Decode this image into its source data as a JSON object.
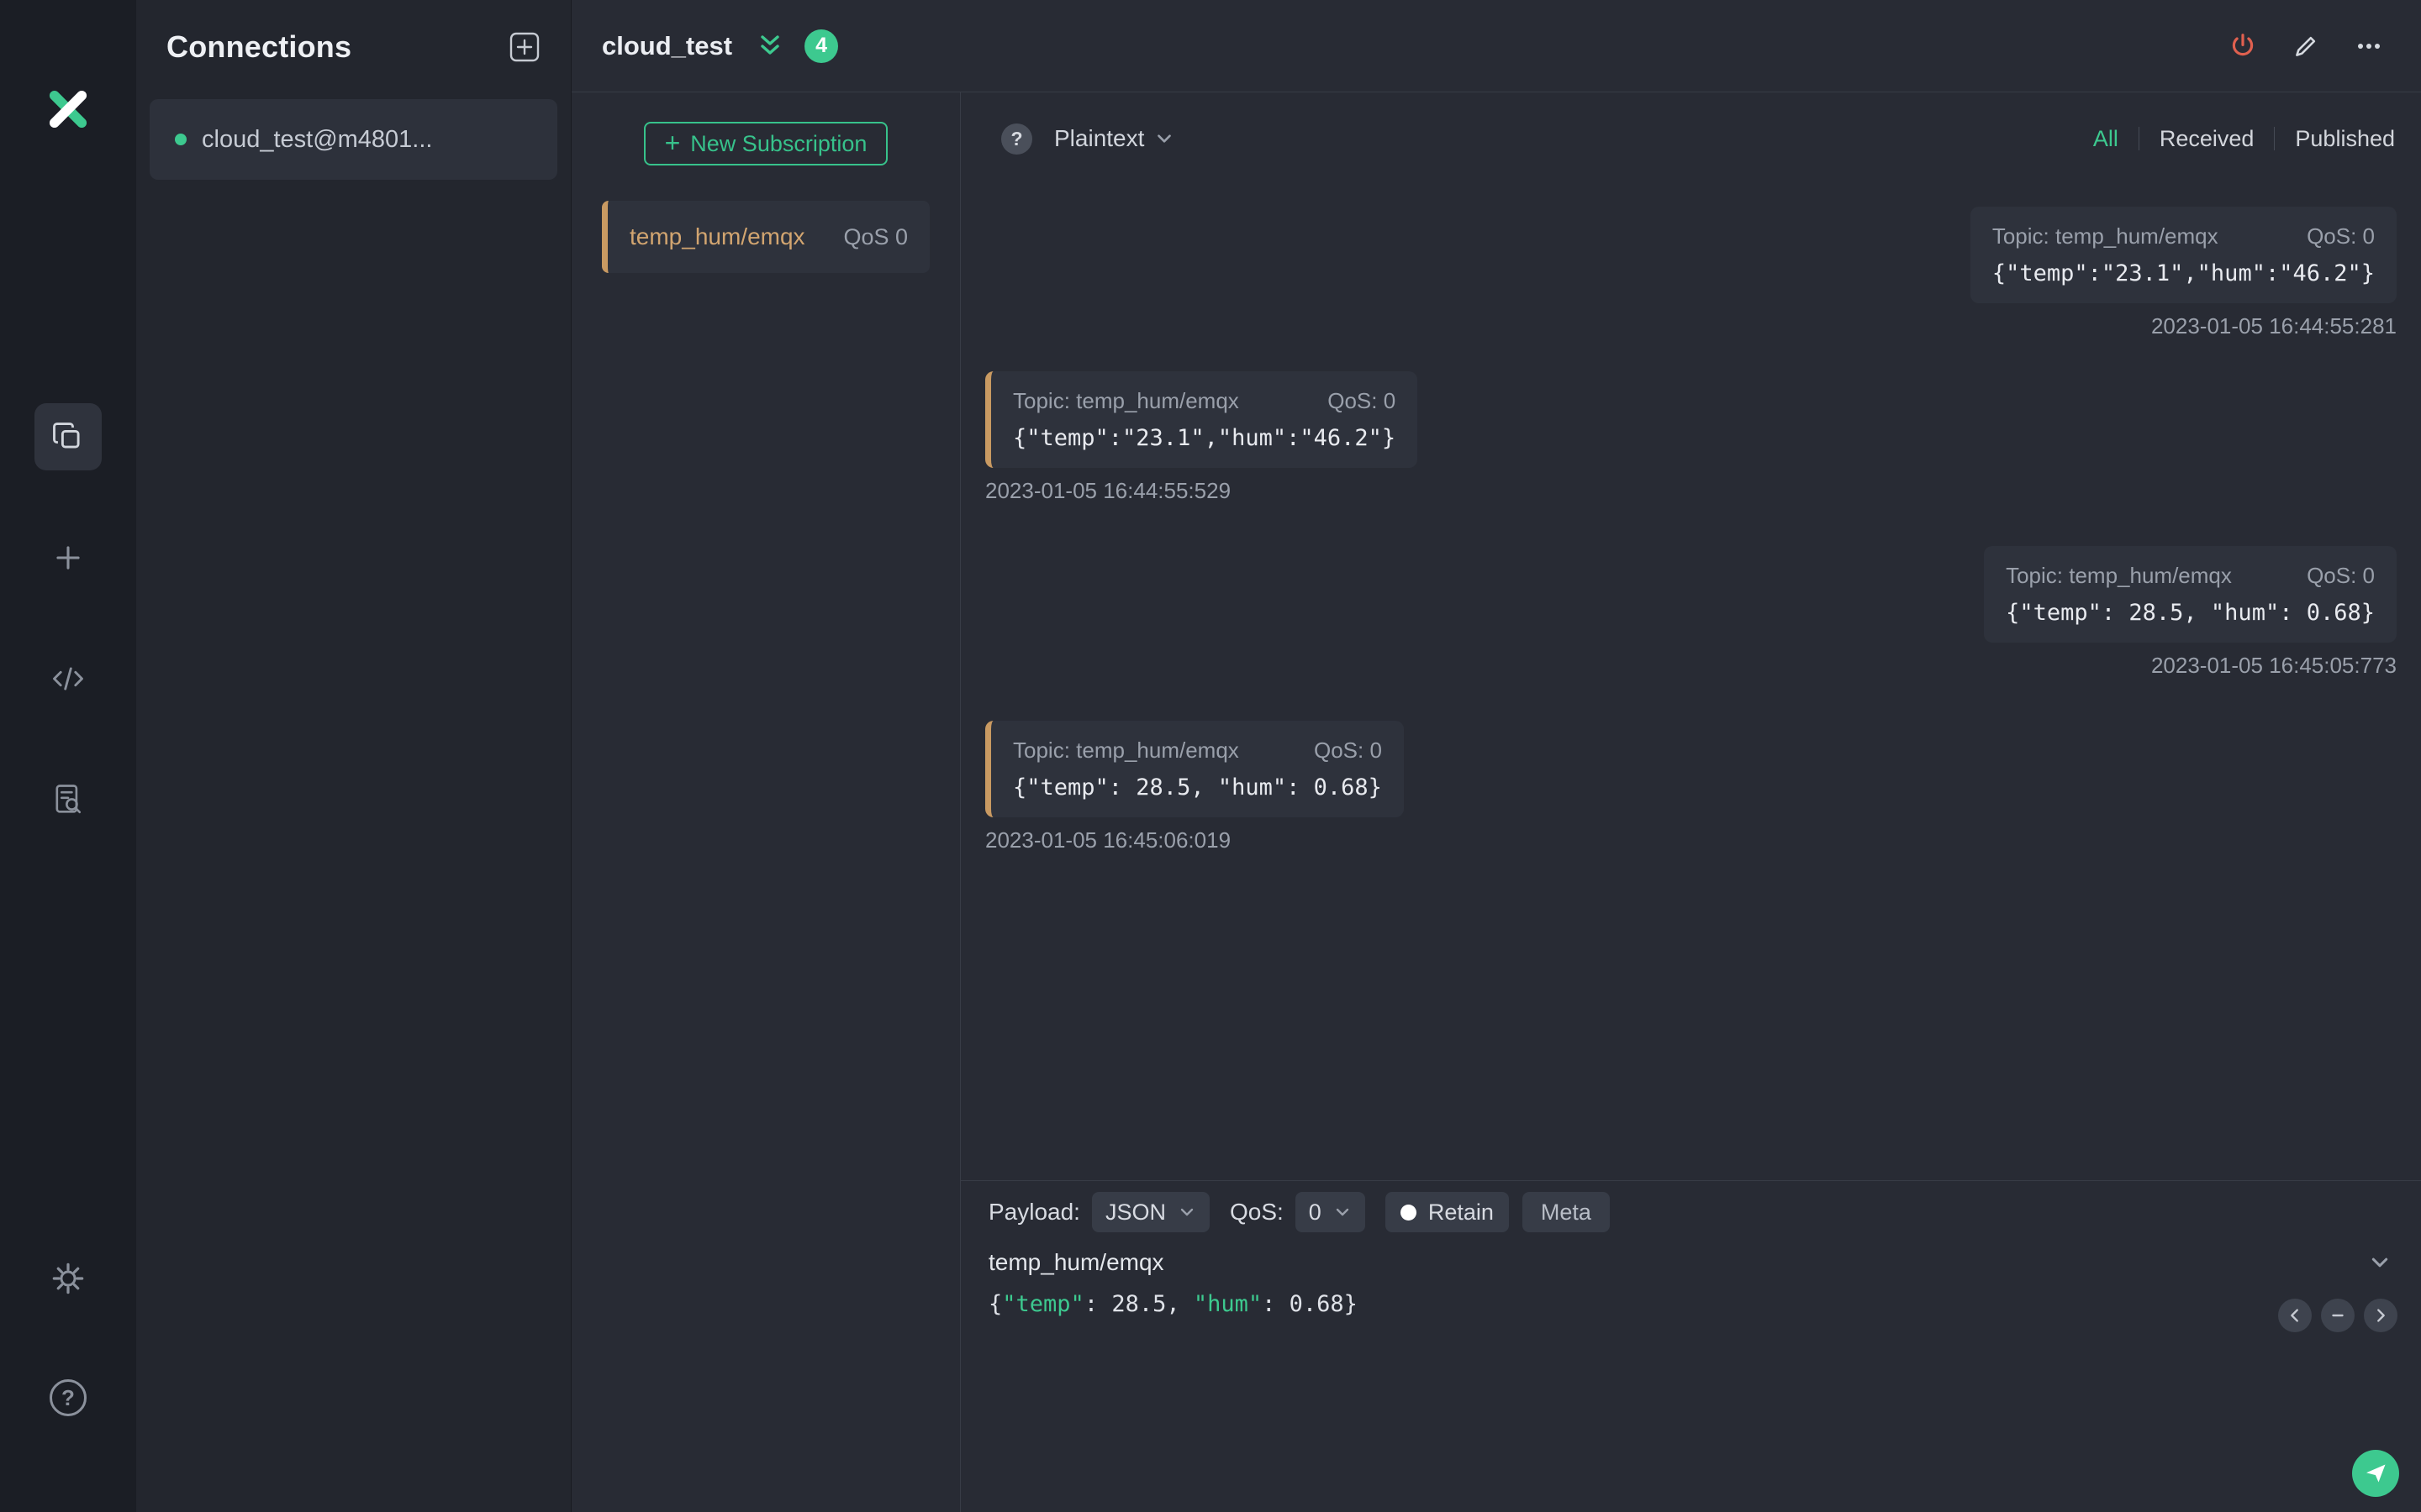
{
  "nav": {
    "icons": [
      "mqttx-logo",
      "connections",
      "new-connection",
      "script",
      "log",
      "settings",
      "help"
    ]
  },
  "connections_panel": {
    "title": "Connections",
    "items": [
      {
        "name": "cloud_test@m4801...",
        "status": "connected"
      }
    ]
  },
  "header": {
    "title": "cloud_test",
    "badge": "4"
  },
  "subscriptions": {
    "new_button_label": "New Subscription",
    "items": [
      {
        "topic": "temp_hum/emqx",
        "qos": "QoS 0"
      }
    ]
  },
  "toolbar": {
    "format": "Plaintext",
    "filters": [
      "All",
      "Received",
      "Published"
    ],
    "active_filter": "All"
  },
  "messages": [
    {
      "direction": "published",
      "topic": "Topic: temp_hum/emqx",
      "qos": "QoS: 0",
      "payload": "{\"temp\":\"23.1\",\"hum\":\"46.2\"}",
      "time": "2023-01-05 16:44:55:281"
    },
    {
      "direction": "received",
      "topic": "Topic: temp_hum/emqx",
      "qos": "QoS: 0",
      "payload": "{\"temp\":\"23.1\",\"hum\":\"46.2\"}",
      "time": "2023-01-05 16:44:55:529"
    },
    {
      "direction": "published",
      "topic": "Topic: temp_hum/emqx",
      "qos": "QoS: 0",
      "payload": "{\"temp\": 28.5, \"hum\": 0.68}",
      "time": "2023-01-05 16:45:05:773"
    },
    {
      "direction": "received",
      "topic": "Topic: temp_hum/emqx",
      "qos": "QoS: 0",
      "payload": "{\"temp\": 28.5, \"hum\": 0.68}",
      "time": "2023-01-05 16:45:06:019"
    }
  ],
  "publish": {
    "payload_label": "Payload:",
    "format_value": "JSON",
    "qos_label": "QoS:",
    "qos_value": "0",
    "retain_label": "Retain",
    "meta_label": "Meta",
    "topic_value": "temp_hum/emqx",
    "payload_segments": [
      {
        "text": "{",
        "type": "plain"
      },
      {
        "text": "\"temp\"",
        "type": "key"
      },
      {
        "text": ": 28.5, ",
        "type": "plain"
      },
      {
        "text": "\"hum\"",
        "type": "key"
      },
      {
        "text": ": 0.68}",
        "type": "plain"
      }
    ]
  },
  "colors": {
    "accent_green": "#3dc98f",
    "accent_orange": "#c99a62",
    "power_red": "#e0604f"
  }
}
